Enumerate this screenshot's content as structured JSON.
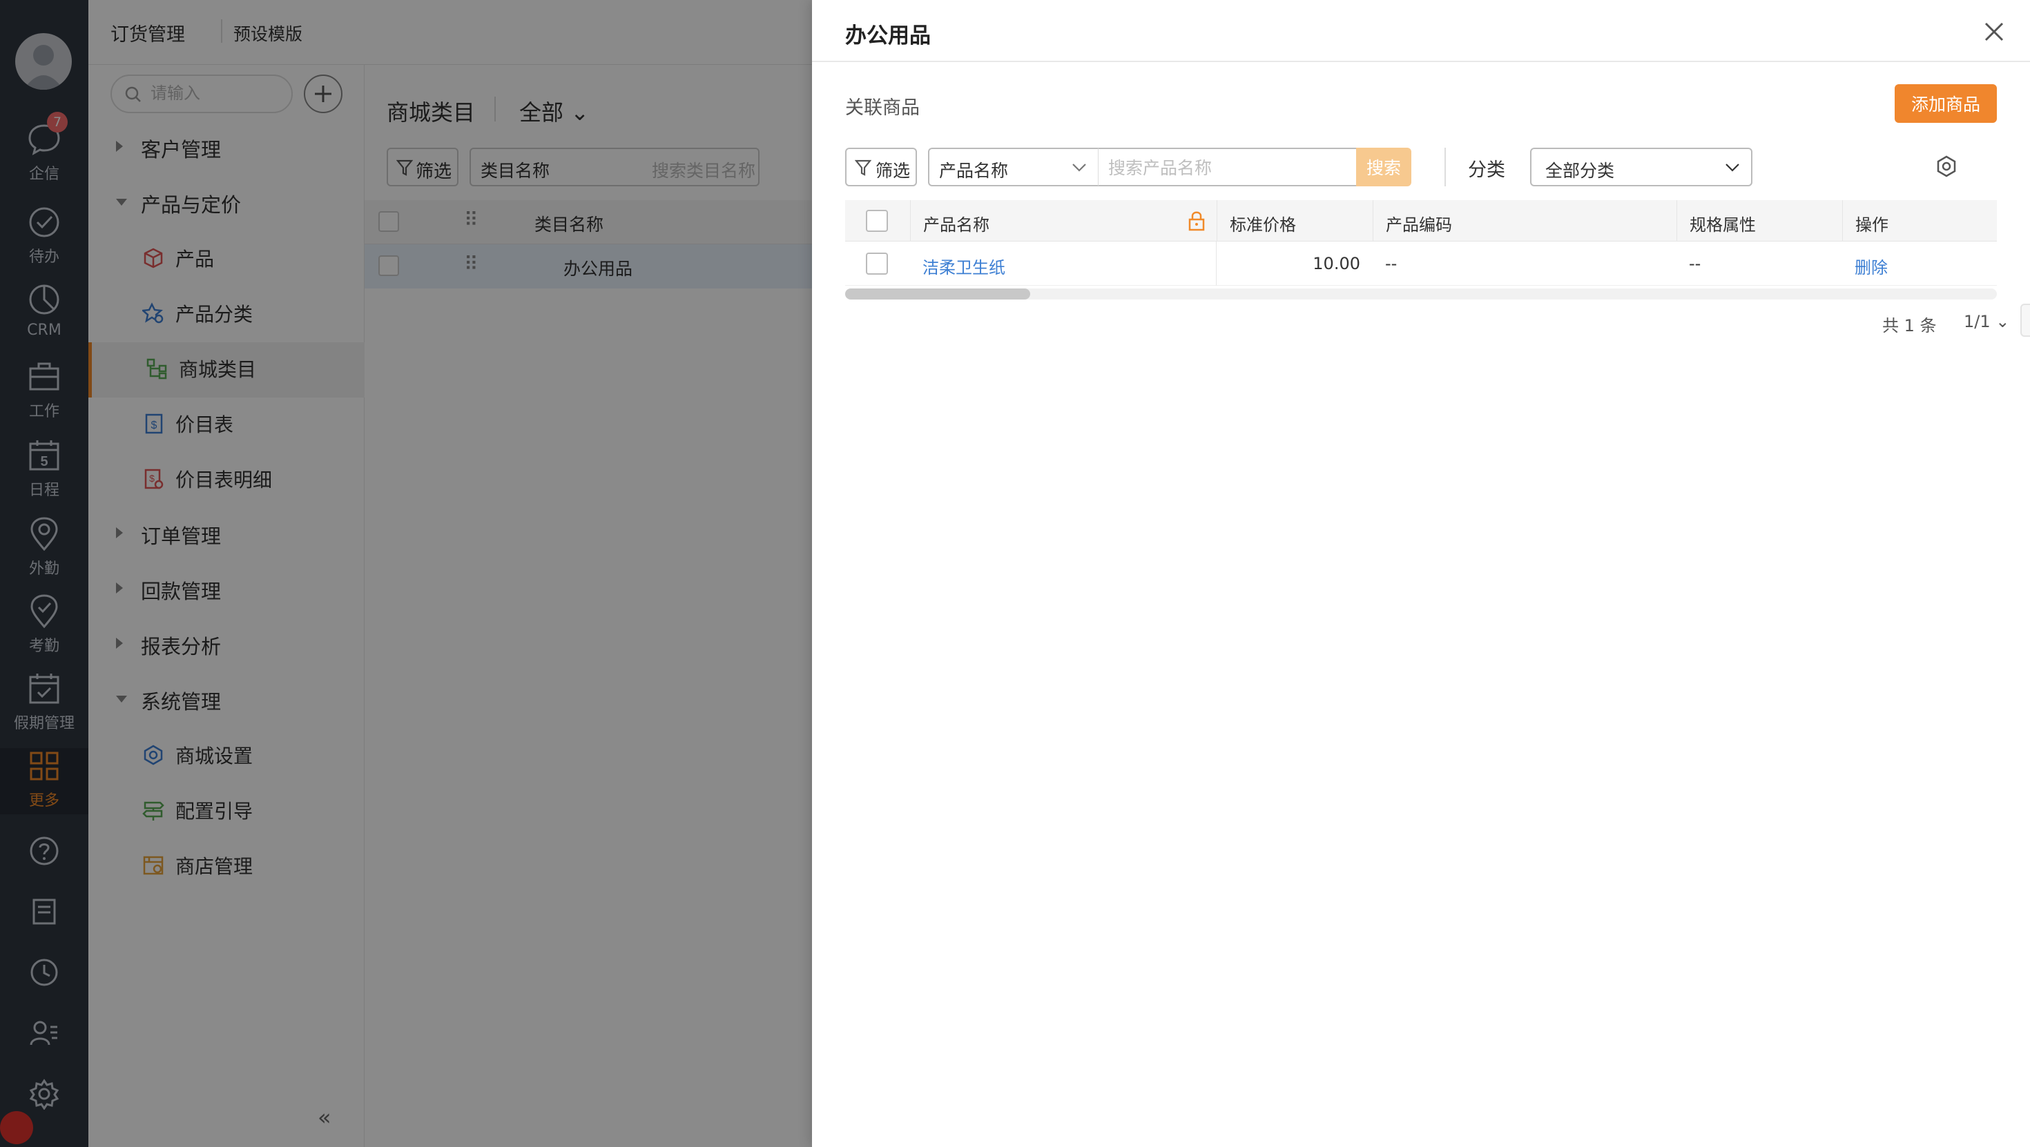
{
  "rail": {
    "items": [
      {
        "label": "企信",
        "icon": "chat-icon",
        "badge": "7"
      },
      {
        "label": "待办",
        "icon": "check-circle-icon"
      },
      {
        "label": "CRM",
        "icon": "pie-chart-icon"
      },
      {
        "label": "工作",
        "icon": "briefcase-icon"
      },
      {
        "label": "日程",
        "icon": "calendar-icon",
        "day": "5"
      },
      {
        "label": "外勤",
        "icon": "map-pin-icon"
      },
      {
        "label": "考勤",
        "icon": "attendance-icon"
      },
      {
        "label": "假期管理",
        "icon": "leave-calendar-icon"
      },
      {
        "label": "更多",
        "icon": "grid-icon",
        "active": true
      }
    ],
    "accent": "#f08a2a"
  },
  "topbar": {
    "crumb_main": "订货管理",
    "crumb_sub": "预设模版"
  },
  "sidebar": {
    "search_placeholder": "请输入",
    "groups": [
      {
        "label": "客户管理",
        "expanded": false
      },
      {
        "label": "产品与定价",
        "expanded": true,
        "items": [
          "产品",
          "产品分类",
          "商城类目",
          "价目表",
          "价目表明细"
        ]
      },
      {
        "label": "订单管理",
        "expanded": false
      },
      {
        "label": "回款管理",
        "expanded": false
      },
      {
        "label": "报表分析",
        "expanded": false
      },
      {
        "label": "系统管理",
        "expanded": true,
        "items": [
          "商城设置",
          "配置引导",
          "商店管理"
        ]
      }
    ],
    "active_item": "商城类目"
  },
  "main": {
    "title": "商城类目",
    "scope": "全部",
    "filter_label": "筛选",
    "field_select": "类目名称",
    "search_placeholder": "搜索类目名称",
    "col_name": "类目名称",
    "rows": [
      "办公用品"
    ]
  },
  "drawer": {
    "title": "办公用品",
    "section": "关联商品",
    "add_button": "添加商品",
    "filter_label": "筛选",
    "field_select": "产品名称",
    "search_placeholder": "搜索产品名称",
    "search_button": "搜索",
    "category_label": "分类",
    "category_value": "全部分类",
    "columns": [
      "产品名称",
      "标准价格",
      "产品编码",
      "规格属性",
      "操作"
    ],
    "rows": [
      {
        "name": "洁柔卫生纸",
        "price": "10.00",
        "code": "--",
        "spec": "--",
        "action": "删除"
      }
    ],
    "total": "共 1 条",
    "page": "1/1"
  }
}
